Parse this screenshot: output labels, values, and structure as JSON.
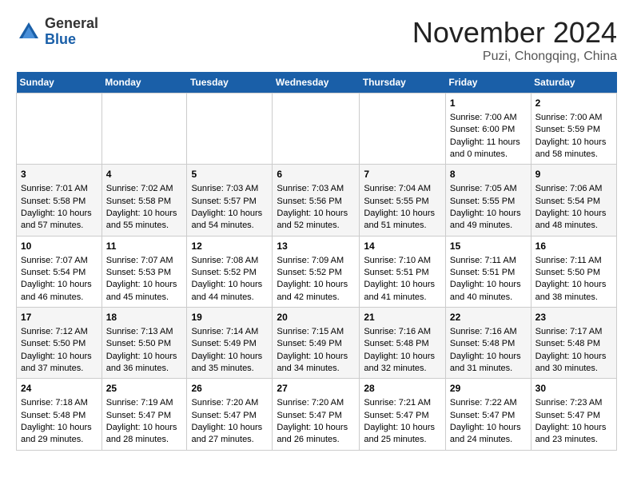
{
  "header": {
    "logo_line1": "General",
    "logo_line2": "Blue",
    "month": "November 2024",
    "location": "Puzi, Chongqing, China"
  },
  "weekdays": [
    "Sunday",
    "Monday",
    "Tuesday",
    "Wednesday",
    "Thursday",
    "Friday",
    "Saturday"
  ],
  "weeks": [
    [
      {
        "day": "",
        "info": ""
      },
      {
        "day": "",
        "info": ""
      },
      {
        "day": "",
        "info": ""
      },
      {
        "day": "",
        "info": ""
      },
      {
        "day": "",
        "info": ""
      },
      {
        "day": "1",
        "info": "Sunrise: 7:00 AM\nSunset: 6:00 PM\nDaylight: 11 hours\nand 0 minutes."
      },
      {
        "day": "2",
        "info": "Sunrise: 7:00 AM\nSunset: 5:59 PM\nDaylight: 10 hours\nand 58 minutes."
      }
    ],
    [
      {
        "day": "3",
        "info": "Sunrise: 7:01 AM\nSunset: 5:58 PM\nDaylight: 10 hours\nand 57 minutes."
      },
      {
        "day": "4",
        "info": "Sunrise: 7:02 AM\nSunset: 5:58 PM\nDaylight: 10 hours\nand 55 minutes."
      },
      {
        "day": "5",
        "info": "Sunrise: 7:03 AM\nSunset: 5:57 PM\nDaylight: 10 hours\nand 54 minutes."
      },
      {
        "day": "6",
        "info": "Sunrise: 7:03 AM\nSunset: 5:56 PM\nDaylight: 10 hours\nand 52 minutes."
      },
      {
        "day": "7",
        "info": "Sunrise: 7:04 AM\nSunset: 5:55 PM\nDaylight: 10 hours\nand 51 minutes."
      },
      {
        "day": "8",
        "info": "Sunrise: 7:05 AM\nSunset: 5:55 PM\nDaylight: 10 hours\nand 49 minutes."
      },
      {
        "day": "9",
        "info": "Sunrise: 7:06 AM\nSunset: 5:54 PM\nDaylight: 10 hours\nand 48 minutes."
      }
    ],
    [
      {
        "day": "10",
        "info": "Sunrise: 7:07 AM\nSunset: 5:54 PM\nDaylight: 10 hours\nand 46 minutes."
      },
      {
        "day": "11",
        "info": "Sunrise: 7:07 AM\nSunset: 5:53 PM\nDaylight: 10 hours\nand 45 minutes."
      },
      {
        "day": "12",
        "info": "Sunrise: 7:08 AM\nSunset: 5:52 PM\nDaylight: 10 hours\nand 44 minutes."
      },
      {
        "day": "13",
        "info": "Sunrise: 7:09 AM\nSunset: 5:52 PM\nDaylight: 10 hours\nand 42 minutes."
      },
      {
        "day": "14",
        "info": "Sunrise: 7:10 AM\nSunset: 5:51 PM\nDaylight: 10 hours\nand 41 minutes."
      },
      {
        "day": "15",
        "info": "Sunrise: 7:11 AM\nSunset: 5:51 PM\nDaylight: 10 hours\nand 40 minutes."
      },
      {
        "day": "16",
        "info": "Sunrise: 7:11 AM\nSunset: 5:50 PM\nDaylight: 10 hours\nand 38 minutes."
      }
    ],
    [
      {
        "day": "17",
        "info": "Sunrise: 7:12 AM\nSunset: 5:50 PM\nDaylight: 10 hours\nand 37 minutes."
      },
      {
        "day": "18",
        "info": "Sunrise: 7:13 AM\nSunset: 5:50 PM\nDaylight: 10 hours\nand 36 minutes."
      },
      {
        "day": "19",
        "info": "Sunrise: 7:14 AM\nSunset: 5:49 PM\nDaylight: 10 hours\nand 35 minutes."
      },
      {
        "day": "20",
        "info": "Sunrise: 7:15 AM\nSunset: 5:49 PM\nDaylight: 10 hours\nand 34 minutes."
      },
      {
        "day": "21",
        "info": "Sunrise: 7:16 AM\nSunset: 5:48 PM\nDaylight: 10 hours\nand 32 minutes."
      },
      {
        "day": "22",
        "info": "Sunrise: 7:16 AM\nSunset: 5:48 PM\nDaylight: 10 hours\nand 31 minutes."
      },
      {
        "day": "23",
        "info": "Sunrise: 7:17 AM\nSunset: 5:48 PM\nDaylight: 10 hours\nand 30 minutes."
      }
    ],
    [
      {
        "day": "24",
        "info": "Sunrise: 7:18 AM\nSunset: 5:48 PM\nDaylight: 10 hours\nand 29 minutes."
      },
      {
        "day": "25",
        "info": "Sunrise: 7:19 AM\nSunset: 5:47 PM\nDaylight: 10 hours\nand 28 minutes."
      },
      {
        "day": "26",
        "info": "Sunrise: 7:20 AM\nSunset: 5:47 PM\nDaylight: 10 hours\nand 27 minutes."
      },
      {
        "day": "27",
        "info": "Sunrise: 7:20 AM\nSunset: 5:47 PM\nDaylight: 10 hours\nand 26 minutes."
      },
      {
        "day": "28",
        "info": "Sunrise: 7:21 AM\nSunset: 5:47 PM\nDaylight: 10 hours\nand 25 minutes."
      },
      {
        "day": "29",
        "info": "Sunrise: 7:22 AM\nSunset: 5:47 PM\nDaylight: 10 hours\nand 24 minutes."
      },
      {
        "day": "30",
        "info": "Sunrise: 7:23 AM\nSunset: 5:47 PM\nDaylight: 10 hours\nand 23 minutes."
      }
    ]
  ]
}
